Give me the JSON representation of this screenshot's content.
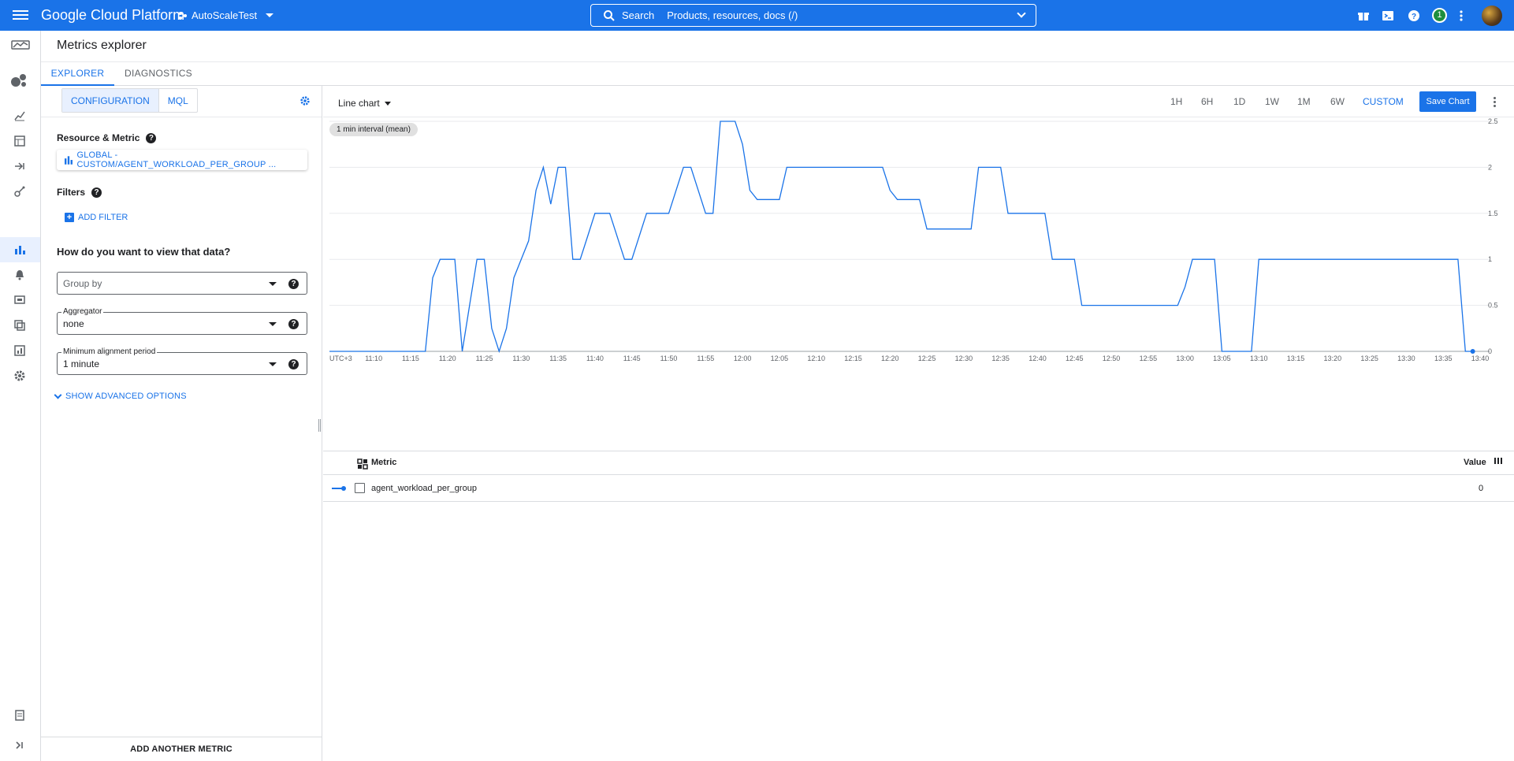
{
  "topbar": {
    "brand": "Google Cloud Platform",
    "project": "AutoScaleTest",
    "search_label": "Search",
    "search_placeholder": "Products, resources, docs (/)",
    "notifications_count": "1",
    "icons": [
      "gift-icon",
      "cloud-shell-icon",
      "help-icon",
      "notifications-badge",
      "more-vert-icon",
      "account-avatar"
    ],
    "color": "#1a73e8"
  },
  "page": {
    "title": "Metrics explorer",
    "tabs": [
      {
        "label": "EXPLORER",
        "active": true
      },
      {
        "label": "DIAGNOSTICS",
        "active": false
      }
    ]
  },
  "config": {
    "modes": [
      {
        "label": "CONFIGURATION",
        "active": true
      },
      {
        "label": "MQL",
        "active": false
      }
    ],
    "resource_metric_label": "Resource & Metric",
    "metric_chip": "GLOBAL - CUSTOM/AGENT_WORKLOAD_PER_GROUP ...",
    "filters_label": "Filters",
    "add_filter": "ADD FILTER",
    "question": "How do you want to view that data?",
    "group_by": {
      "placeholder": "Group by"
    },
    "aggregator": {
      "label": "Aggregator",
      "value": "none"
    },
    "alignment": {
      "label": "Minimum alignment period",
      "value": "1 minute"
    },
    "advanced": "SHOW ADVANCED OPTIONS",
    "add_another": "ADD ANOTHER METRIC"
  },
  "chart_toolbar": {
    "chart_type": "Line chart",
    "ranges": [
      "1H",
      "6H",
      "1D",
      "1W",
      "1M",
      "6W",
      "CUSTOM"
    ],
    "active_range": "CUSTOM",
    "save": "Save Chart"
  },
  "chart_data": {
    "type": "line",
    "interval_chip": "1 min interval (mean)",
    "timezone": "UTC+3",
    "x_ticks": [
      "11:10",
      "11:15",
      "11:20",
      "11:25",
      "11:30",
      "11:35",
      "11:40",
      "11:45",
      "11:50",
      "11:55",
      "12:00",
      "12:05",
      "12:10",
      "12:15",
      "12:20",
      "12:25",
      "12:30",
      "12:35",
      "12:40",
      "12:45",
      "12:50",
      "12:55",
      "13:00",
      "13:05",
      "13:10",
      "13:15",
      "13:20",
      "13:25",
      "13:30",
      "13:35",
      "13:40"
    ],
    "y_ticks": [
      "0",
      "0.5",
      "1",
      "1.5",
      "2",
      "2.5"
    ],
    "ylim": [
      0,
      2.5
    ],
    "xlim": [
      "11:04",
      "13:40"
    ],
    "grid": true,
    "color": "#1a73e8",
    "series": [
      {
        "name": "agent_workload_per_group",
        "points": [
          [
            "11:04",
            0
          ],
          [
            "11:10",
            0
          ],
          [
            "11:15",
            0
          ],
          [
            "11:17",
            0
          ],
          [
            "11:18",
            0.8
          ],
          [
            "11:19",
            1
          ],
          [
            "11:21",
            1
          ],
          [
            "11:22",
            0
          ],
          [
            "11:23",
            0.5
          ],
          [
            "11:24",
            1
          ],
          [
            "11:25",
            1
          ],
          [
            "11:26",
            0.25
          ],
          [
            "11:27",
            0
          ],
          [
            "11:28",
            0.25
          ],
          [
            "11:29",
            0.8
          ],
          [
            "11:30",
            1
          ],
          [
            "11:31",
            1.2
          ],
          [
            "11:32",
            1.75
          ],
          [
            "11:33",
            2
          ],
          [
            "11:34",
            1.6
          ],
          [
            "11:35",
            2
          ],
          [
            "11:36",
            2
          ],
          [
            "11:37",
            1
          ],
          [
            "11:38",
            1
          ],
          [
            "11:39",
            1.25
          ],
          [
            "11:40",
            1.5
          ],
          [
            "11:42",
            1.5
          ],
          [
            "11:44",
            1
          ],
          [
            "11:45",
            1
          ],
          [
            "11:47",
            1.5
          ],
          [
            "11:50",
            1.5
          ],
          [
            "11:52",
            2
          ],
          [
            "11:53",
            2
          ],
          [
            "11:55",
            1.5
          ],
          [
            "11:56",
            1.5
          ],
          [
            "11:57",
            2.5
          ],
          [
            "11:59",
            2.5
          ],
          [
            "12:00",
            2.25
          ],
          [
            "12:01",
            1.75
          ],
          [
            "12:02",
            1.65
          ],
          [
            "12:05",
            1.65
          ],
          [
            "12:06",
            2
          ],
          [
            "12:19",
            2
          ],
          [
            "12:20",
            1.75
          ],
          [
            "12:21",
            1.65
          ],
          [
            "12:24",
            1.65
          ],
          [
            "12:25",
            1.33
          ],
          [
            "12:31",
            1.33
          ],
          [
            "12:32",
            2
          ],
          [
            "12:35",
            2
          ],
          [
            "12:36",
            1.5
          ],
          [
            "12:41",
            1.5
          ],
          [
            "12:42",
            1
          ],
          [
            "12:45",
            1
          ],
          [
            "12:46",
            0.5
          ],
          [
            "12:59",
            0.5
          ],
          [
            "13:00",
            0.7
          ],
          [
            "13:01",
            1
          ],
          [
            "13:04",
            1
          ],
          [
            "13:05",
            0
          ],
          [
            "13:09",
            0
          ],
          [
            "13:10",
            1
          ],
          [
            "13:37",
            1
          ],
          [
            "13:38",
            0
          ],
          [
            "13:39",
            0
          ]
        ]
      }
    ]
  },
  "legend": {
    "col_metric": "Metric",
    "col_value": "Value",
    "rows": [
      {
        "name": "agent_workload_per_group",
        "value": "0"
      }
    ]
  }
}
